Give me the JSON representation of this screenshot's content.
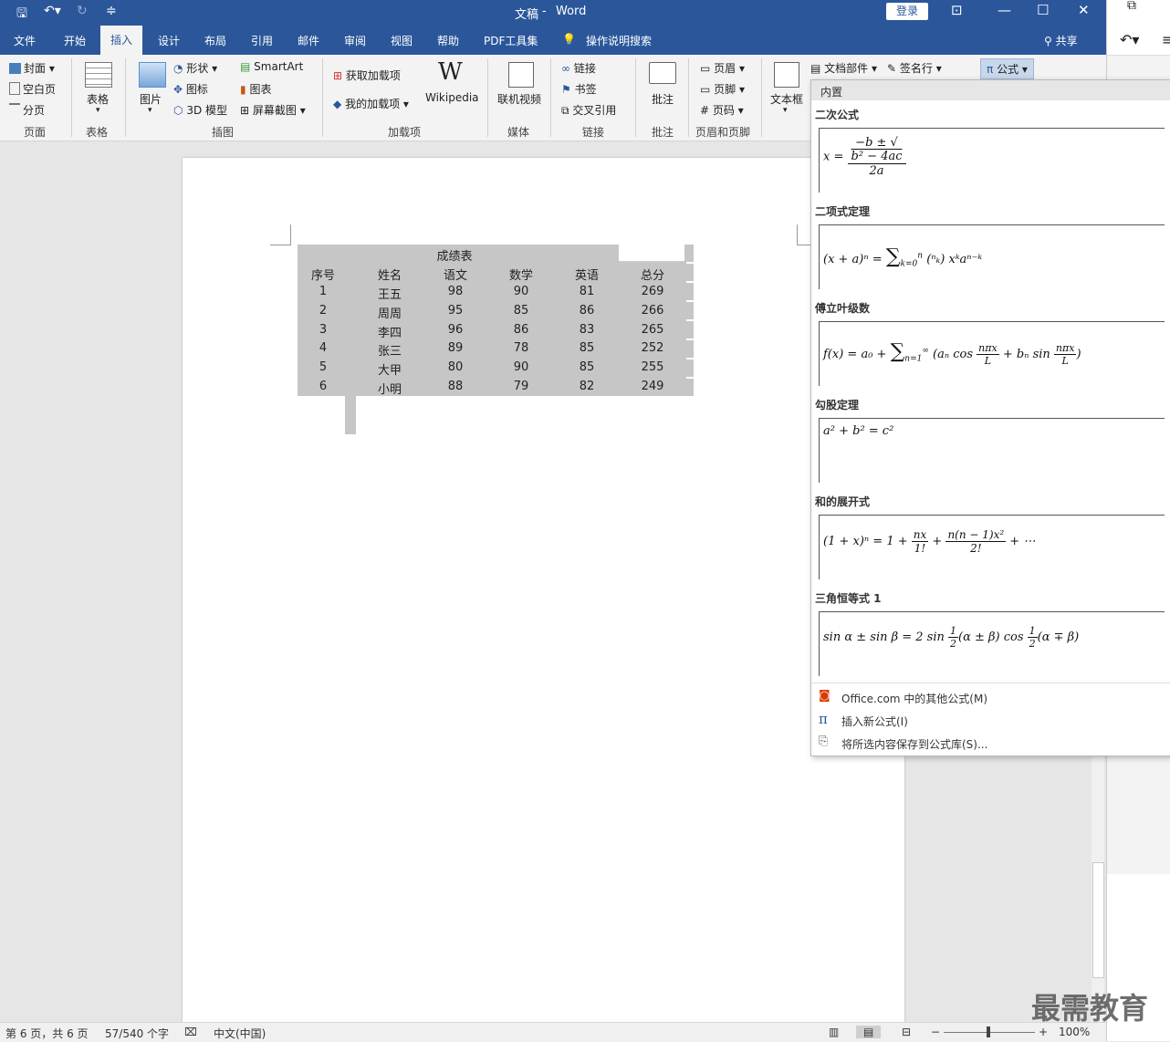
{
  "window": {
    "doc_title": "文稿",
    "app_title": "Word",
    "login": "登录",
    "share": "共享"
  },
  "tabs": [
    "文件",
    "开始",
    "插入",
    "设计",
    "布局",
    "引用",
    "邮件",
    "审阅",
    "视图",
    "帮助",
    "PDF工具集"
  ],
  "tellme": "操作说明搜索",
  "ribbon": {
    "pages": {
      "cover": "封面",
      "blank": "空白页",
      "break": "分页",
      "group": "页面"
    },
    "tables": {
      "table": "表格",
      "group": "表格"
    },
    "illustrations": {
      "picture": "图片",
      "shapes": "形状",
      "icons": "图标",
      "model3d": "3D 模型",
      "smartart": "SmartArt",
      "chart": "图表",
      "screenshot": "屏幕截图",
      "group": "插图"
    },
    "addins": {
      "get": "获取加载项",
      "mine": "我的加载项",
      "wikipedia": "Wikipedia",
      "group": "加载项"
    },
    "media": {
      "video": "联机视频",
      "group": "媒体"
    },
    "links": {
      "link": "链接",
      "bookmark": "书签",
      "crossref": "交叉引用",
      "group": "链接"
    },
    "comments": {
      "comment": "批注",
      "group": "批注"
    },
    "headerfooter": {
      "header": "页眉",
      "footer": "页脚",
      "pagenum": "页码",
      "group": "页眉和页脚"
    },
    "text": {
      "textbox": "文本框",
      "docparts": "文档部件",
      "signature": "签名行"
    },
    "symbols": {
      "equation": "公式"
    }
  },
  "table": {
    "title": "成绩表",
    "headers": [
      "序号",
      "姓名",
      "语文",
      "数学",
      "英语",
      "总分"
    ],
    "rows": [
      [
        "1",
        "王五",
        "98",
        "90",
        "81",
        "269"
      ],
      [
        "2",
        "周周",
        "95",
        "85",
        "86",
        "266"
      ],
      [
        "3",
        "李四",
        "96",
        "86",
        "83",
        "265"
      ],
      [
        "4",
        "张三",
        "89",
        "78",
        "85",
        "252"
      ],
      [
        "5",
        "大甲",
        "80",
        "90",
        "85",
        "255"
      ],
      [
        "6",
        "小明",
        "88",
        "79",
        "82",
        "249"
      ]
    ]
  },
  "equations": {
    "header": "内置",
    "items": [
      {
        "name": "二次公式"
      },
      {
        "name": "二项式定理"
      },
      {
        "name": "傅立叶级数"
      },
      {
        "name": "勾股定理"
      },
      {
        "name": "和的展开式"
      },
      {
        "name": "三角恒等式 1"
      }
    ],
    "footer": [
      "Office.com 中的其他公式(M)",
      "插入新公式(I)",
      "将所选内容保存到公式库(S)..."
    ]
  },
  "status": {
    "page": "第 6 页，共 6 页",
    "words": "57/540 个字",
    "lang": "中文(中国)",
    "zoom": "100%"
  },
  "watermark": "最需教育"
}
